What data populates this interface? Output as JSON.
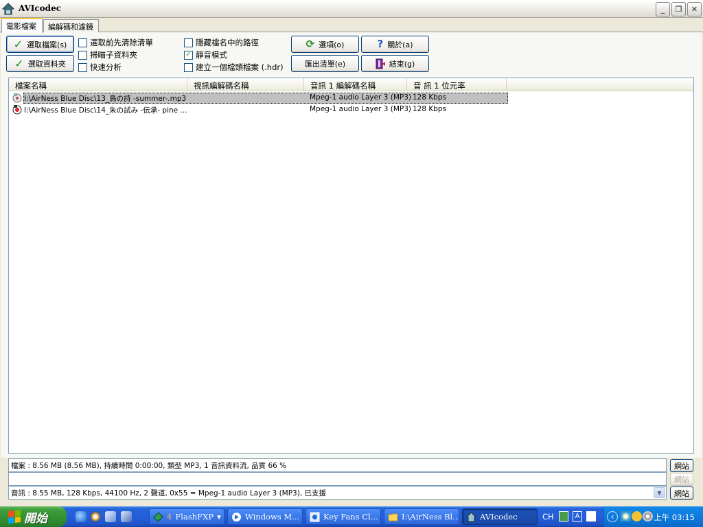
{
  "window": {
    "title": "AVIcodec",
    "minimize_glyph": "_",
    "restore_glyph": "❐",
    "close_glyph": "✕"
  },
  "tabs": [
    {
      "label": "電影檔案",
      "active": true
    },
    {
      "label": "編解碼和濾鏡",
      "active": false
    }
  ],
  "buttons": {
    "select_file": "選取檔案(s)",
    "select_folder": "選取資料夾",
    "options": "選項(o)",
    "about": "關於(a)",
    "export_list": "匯出清單(e)",
    "exit": "結束(g)"
  },
  "checkboxes": [
    {
      "label": "選取前先清除清單",
      "checked": false
    },
    {
      "label": "掃瞄子資料夾",
      "checked": false
    },
    {
      "label": "快速分析",
      "checked": false
    },
    {
      "label": "隱藏檔名中的路徑",
      "checked": false
    },
    {
      "label": "靜音模式",
      "checked": true
    },
    {
      "label": "建立一個檔頭檔案 (.hdr)",
      "checked": false
    }
  ],
  "check_glyph": "✓",
  "list": {
    "columns": [
      "檔案名稱",
      "視訊編解碼名稱",
      "音訊 1 編解碼名稱",
      "音 訊 1 位元率"
    ],
    "rows": [
      {
        "file": "I:\\AirNess Blue Disc\\13_鳥の詩 -summer-.mp3",
        "video_codec": "",
        "audio_codec": "Mpeg-1 audio Layer 3 (MP3)",
        "bitrate": "128 Kbps",
        "selected": true
      },
      {
        "file": "I:\\AirNess Blue Disc\\14_朱の試み -伝承- pine ...",
        "video_codec": "",
        "audio_codec": "Mpeg-1 audio Layer 3 (MP3)",
        "bitrate": "128 Kbps",
        "selected": false
      }
    ]
  },
  "info": {
    "file_line": "檔案 : 8.56 MB (8.56 MB), 持續時間 0:00:00, 類型 MP3, 1 音訊資料流, 品質 66 %",
    "empty_line": "",
    "audio_line": "音訊 : 8.55 MB, 128 Kbps, 44100 Hz, 2 聲道, 0x55 = Mpeg-1 audio Layer 3 (MP3), 已支援",
    "website_label": "網站",
    "combo_arrow": "▼"
  },
  "taskbar": {
    "start_label": "開始",
    "tasks": [
      {
        "label": "FlashFXP",
        "badge": "4",
        "active": false,
        "dropdown": "▾"
      },
      {
        "label": "Windows M...",
        "active": false
      },
      {
        "label": "Key Fans Cl...",
        "active": false
      },
      {
        "label": "I:\\AirNess Bl...",
        "active": false
      },
      {
        "label": "AVIcodec",
        "active": true
      }
    ],
    "ime_lang": "CH",
    "ime_mode": "A",
    "tray_chevron": "‹",
    "clock": "上午 03:15"
  }
}
